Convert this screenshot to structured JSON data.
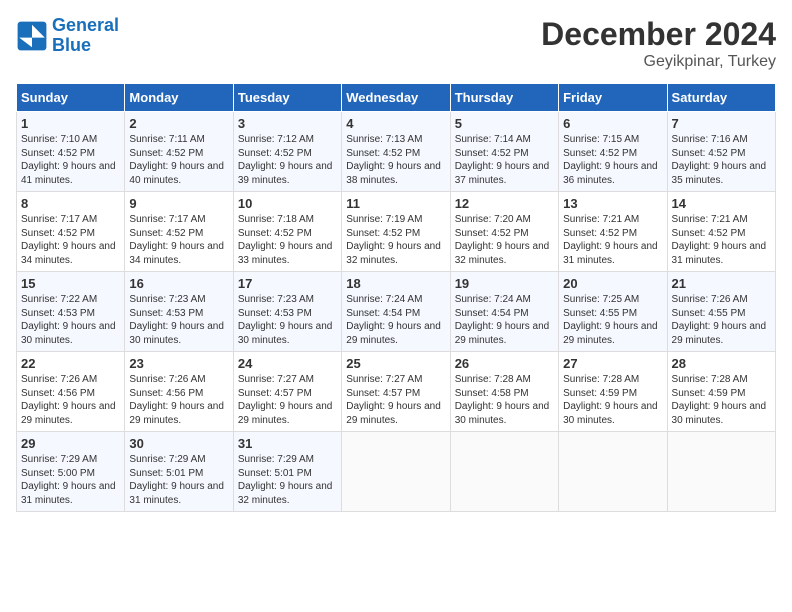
{
  "logo": {
    "line1": "General",
    "line2": "Blue"
  },
  "title": "December 2024",
  "subtitle": "Geyikpinar, Turkey",
  "days_of_week": [
    "Sunday",
    "Monday",
    "Tuesday",
    "Wednesday",
    "Thursday",
    "Friday",
    "Saturday"
  ],
  "weeks": [
    [
      {
        "day": "1",
        "sunrise": "7:10 AM",
        "sunset": "4:52 PM",
        "daylight": "9 hours and 41 minutes."
      },
      {
        "day": "2",
        "sunrise": "7:11 AM",
        "sunset": "4:52 PM",
        "daylight": "9 hours and 40 minutes."
      },
      {
        "day": "3",
        "sunrise": "7:12 AM",
        "sunset": "4:52 PM",
        "daylight": "9 hours and 39 minutes."
      },
      {
        "day": "4",
        "sunrise": "7:13 AM",
        "sunset": "4:52 PM",
        "daylight": "9 hours and 38 minutes."
      },
      {
        "day": "5",
        "sunrise": "7:14 AM",
        "sunset": "4:52 PM",
        "daylight": "9 hours and 37 minutes."
      },
      {
        "day": "6",
        "sunrise": "7:15 AM",
        "sunset": "4:52 PM",
        "daylight": "9 hours and 36 minutes."
      },
      {
        "day": "7",
        "sunrise": "7:16 AM",
        "sunset": "4:52 PM",
        "daylight": "9 hours and 35 minutes."
      }
    ],
    [
      {
        "day": "8",
        "sunrise": "7:17 AM",
        "sunset": "4:52 PM",
        "daylight": "9 hours and 34 minutes."
      },
      {
        "day": "9",
        "sunrise": "7:17 AM",
        "sunset": "4:52 PM",
        "daylight": "9 hours and 34 minutes."
      },
      {
        "day": "10",
        "sunrise": "7:18 AM",
        "sunset": "4:52 PM",
        "daylight": "9 hours and 33 minutes."
      },
      {
        "day": "11",
        "sunrise": "7:19 AM",
        "sunset": "4:52 PM",
        "daylight": "9 hours and 32 minutes."
      },
      {
        "day": "12",
        "sunrise": "7:20 AM",
        "sunset": "4:52 PM",
        "daylight": "9 hours and 32 minutes."
      },
      {
        "day": "13",
        "sunrise": "7:21 AM",
        "sunset": "4:52 PM",
        "daylight": "9 hours and 31 minutes."
      },
      {
        "day": "14",
        "sunrise": "7:21 AM",
        "sunset": "4:52 PM",
        "daylight": "9 hours and 31 minutes."
      }
    ],
    [
      {
        "day": "15",
        "sunrise": "7:22 AM",
        "sunset": "4:53 PM",
        "daylight": "9 hours and 30 minutes."
      },
      {
        "day": "16",
        "sunrise": "7:23 AM",
        "sunset": "4:53 PM",
        "daylight": "9 hours and 30 minutes."
      },
      {
        "day": "17",
        "sunrise": "7:23 AM",
        "sunset": "4:53 PM",
        "daylight": "9 hours and 30 minutes."
      },
      {
        "day": "18",
        "sunrise": "7:24 AM",
        "sunset": "4:54 PM",
        "daylight": "9 hours and 29 minutes."
      },
      {
        "day": "19",
        "sunrise": "7:24 AM",
        "sunset": "4:54 PM",
        "daylight": "9 hours and 29 minutes."
      },
      {
        "day": "20",
        "sunrise": "7:25 AM",
        "sunset": "4:55 PM",
        "daylight": "9 hours and 29 minutes."
      },
      {
        "day": "21",
        "sunrise": "7:26 AM",
        "sunset": "4:55 PM",
        "daylight": "9 hours and 29 minutes."
      }
    ],
    [
      {
        "day": "22",
        "sunrise": "7:26 AM",
        "sunset": "4:56 PM",
        "daylight": "9 hours and 29 minutes."
      },
      {
        "day": "23",
        "sunrise": "7:26 AM",
        "sunset": "4:56 PM",
        "daylight": "9 hours and 29 minutes."
      },
      {
        "day": "24",
        "sunrise": "7:27 AM",
        "sunset": "4:57 PM",
        "daylight": "9 hours and 29 minutes."
      },
      {
        "day": "25",
        "sunrise": "7:27 AM",
        "sunset": "4:57 PM",
        "daylight": "9 hours and 29 minutes."
      },
      {
        "day": "26",
        "sunrise": "7:28 AM",
        "sunset": "4:58 PM",
        "daylight": "9 hours and 30 minutes."
      },
      {
        "day": "27",
        "sunrise": "7:28 AM",
        "sunset": "4:59 PM",
        "daylight": "9 hours and 30 minutes."
      },
      {
        "day": "28",
        "sunrise": "7:28 AM",
        "sunset": "4:59 PM",
        "daylight": "9 hours and 30 minutes."
      }
    ],
    [
      {
        "day": "29",
        "sunrise": "7:29 AM",
        "sunset": "5:00 PM",
        "daylight": "9 hours and 31 minutes."
      },
      {
        "day": "30",
        "sunrise": "7:29 AM",
        "sunset": "5:01 PM",
        "daylight": "9 hours and 31 minutes."
      },
      {
        "day": "31",
        "sunrise": "7:29 AM",
        "sunset": "5:01 PM",
        "daylight": "9 hours and 32 minutes."
      },
      null,
      null,
      null,
      null
    ]
  ]
}
